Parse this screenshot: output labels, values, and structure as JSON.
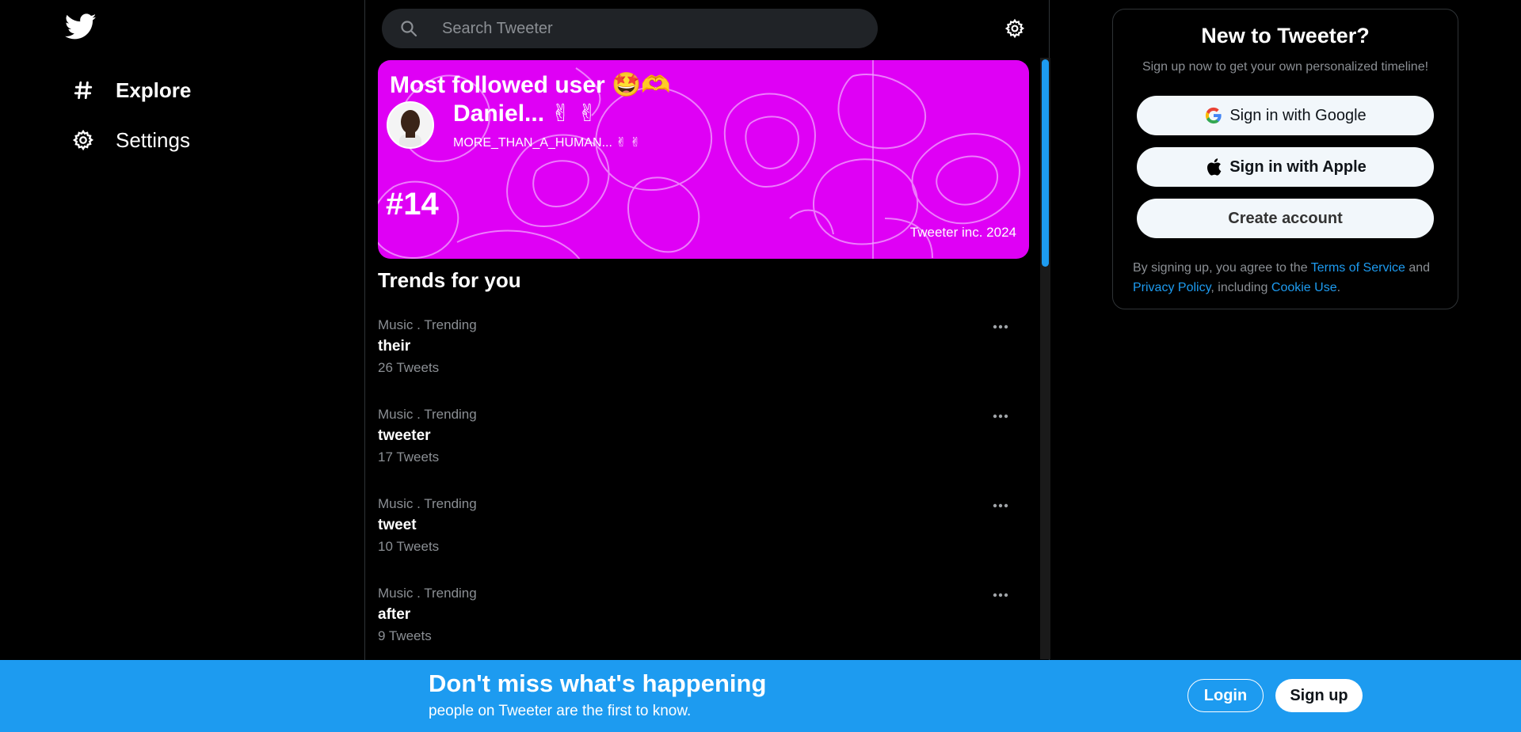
{
  "app": {
    "name": "Tweeter"
  },
  "sidebar": {
    "logo_icon": "twitter-bird-icon",
    "items": [
      {
        "label": "Explore",
        "icon": "hashtag-icon"
      },
      {
        "label": "Settings",
        "icon": "gear-icon"
      }
    ]
  },
  "search": {
    "placeholder": "Search Tweeter",
    "icon": "search-icon"
  },
  "banner": {
    "title": "Most followed user 🤩🫶",
    "user_name": "Daniel... ✌ ✌",
    "user_handle": "MORE_THAN_A_HUMAN... ✌ ✌",
    "rank": "#14",
    "copyright": "Tweeter inc. 2024",
    "background_color": "#df00f5"
  },
  "trends": {
    "title": "Trends for you",
    "items": [
      {
        "category": "Music . Trending",
        "name": "their",
        "count": "26 Tweets"
      },
      {
        "category": "Music . Trending",
        "name": "tweeter",
        "count": "17 Tweets"
      },
      {
        "category": "Music . Trending",
        "name": "tweet",
        "count": "10 Tweets"
      },
      {
        "category": "Music . Trending",
        "name": "after",
        "count": "9 Tweets"
      }
    ]
  },
  "signup_panel": {
    "title": "New to Tweeter?",
    "subtitle": "Sign up now to get your own personalized timeline!",
    "google_label": "Sign in with Google",
    "apple_label": "Sign in with Apple",
    "create_label": "Create account",
    "legal_prefix": "By signing up, you agree to the ",
    "terms_link": "Terms of Service",
    "legal_and": " and ",
    "privacy_link": "Privacy Policy",
    "legal_including": ", including ",
    "cookie_link": "Cookie Use",
    "legal_end": "."
  },
  "bottom_bar": {
    "title": "Don't miss what's happening",
    "subtitle": "people on Tweeter are the first to know.",
    "login_label": "Login",
    "signup_label": "Sign up",
    "background_color": "#1d9bf0"
  },
  "colors": {
    "accent": "#1d9bf0",
    "background": "#000000"
  }
}
